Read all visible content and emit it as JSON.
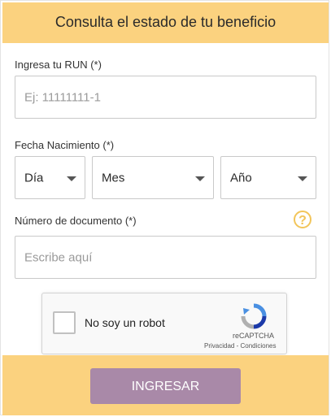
{
  "header": {
    "title": "Consulta el estado de tu beneficio"
  },
  "run": {
    "label": "Ingresa tu RUN (*)",
    "placeholder": "Ej: 11111111-1"
  },
  "birth": {
    "label": "Fecha Nacimiento (*)",
    "day": "Día",
    "month": "Mes",
    "year": "Año"
  },
  "document": {
    "label": "Número de documento (*)",
    "placeholder": "Escribe aquí",
    "help_glyph": "?"
  },
  "captcha": {
    "label": "No soy un robot",
    "brand": "reCAPTCHA",
    "links": "Privacidad - Condiciones"
  },
  "submit": {
    "label": "INGRESAR"
  },
  "colors": {
    "accent": "#fbd27f",
    "button": "#a989a8",
    "help": "#f2c55a"
  }
}
